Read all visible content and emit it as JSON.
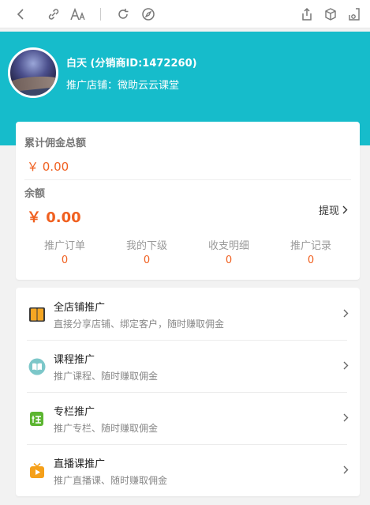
{
  "browser": {
    "icons": [
      "back-icon",
      "link-icon",
      "font-size-icon",
      "refresh-icon",
      "compass-icon",
      "share-icon",
      "box-icon",
      "lock-screen-icon"
    ]
  },
  "profile": {
    "name": "白天 (分销商ID:1472260)",
    "shop": "推广店铺：微助云云课堂"
  },
  "commission": {
    "total_label": "累计佣金总额",
    "total_value": "￥ 0.00",
    "balance_label": "余额",
    "balance_value": "￥ 0.00",
    "withdraw_label": "提现"
  },
  "stats": [
    {
      "label": "推广订单",
      "value": "0"
    },
    {
      "label": "我的下级",
      "value": "0"
    },
    {
      "label": "收支明细",
      "value": "0"
    },
    {
      "label": "推广记录",
      "value": "0"
    }
  ],
  "menu": [
    {
      "title": "全店铺推广",
      "desc": "直接分享店铺、绑定客户，随时赚取佣金",
      "icon": "book-icon"
    },
    {
      "title": "课程推广",
      "desc": "推广课程、随时赚取佣金",
      "icon": "open-book-icon"
    },
    {
      "title": "专栏推广",
      "desc": "推广专栏、随时赚取佣金",
      "icon": "column-icon"
    },
    {
      "title": "直播课推广",
      "desc": "推广直播课、随时赚取佣金",
      "icon": "tv-icon"
    }
  ],
  "colors": {
    "header": "#16bccb",
    "accent": "#f06020"
  }
}
